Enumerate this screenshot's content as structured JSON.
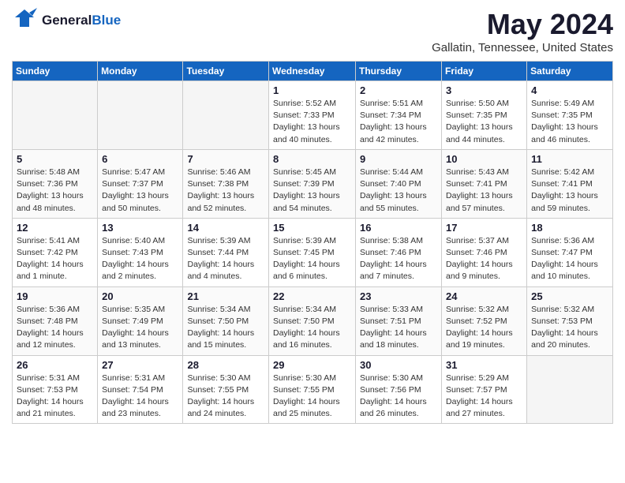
{
  "header": {
    "logo_general": "General",
    "logo_blue": "Blue",
    "month_title": "May 2024",
    "location": "Gallatin, Tennessee, United States"
  },
  "days_of_week": [
    "Sunday",
    "Monday",
    "Tuesday",
    "Wednesday",
    "Thursday",
    "Friday",
    "Saturday"
  ],
  "weeks": [
    [
      {
        "day": "",
        "info": ""
      },
      {
        "day": "",
        "info": ""
      },
      {
        "day": "",
        "info": ""
      },
      {
        "day": "1",
        "info": "Sunrise: 5:52 AM\nSunset: 7:33 PM\nDaylight: 13 hours\nand 40 minutes."
      },
      {
        "day": "2",
        "info": "Sunrise: 5:51 AM\nSunset: 7:34 PM\nDaylight: 13 hours\nand 42 minutes."
      },
      {
        "day": "3",
        "info": "Sunrise: 5:50 AM\nSunset: 7:35 PM\nDaylight: 13 hours\nand 44 minutes."
      },
      {
        "day": "4",
        "info": "Sunrise: 5:49 AM\nSunset: 7:35 PM\nDaylight: 13 hours\nand 46 minutes."
      }
    ],
    [
      {
        "day": "5",
        "info": "Sunrise: 5:48 AM\nSunset: 7:36 PM\nDaylight: 13 hours\nand 48 minutes."
      },
      {
        "day": "6",
        "info": "Sunrise: 5:47 AM\nSunset: 7:37 PM\nDaylight: 13 hours\nand 50 minutes."
      },
      {
        "day": "7",
        "info": "Sunrise: 5:46 AM\nSunset: 7:38 PM\nDaylight: 13 hours\nand 52 minutes."
      },
      {
        "day": "8",
        "info": "Sunrise: 5:45 AM\nSunset: 7:39 PM\nDaylight: 13 hours\nand 54 minutes."
      },
      {
        "day": "9",
        "info": "Sunrise: 5:44 AM\nSunset: 7:40 PM\nDaylight: 13 hours\nand 55 minutes."
      },
      {
        "day": "10",
        "info": "Sunrise: 5:43 AM\nSunset: 7:41 PM\nDaylight: 13 hours\nand 57 minutes."
      },
      {
        "day": "11",
        "info": "Sunrise: 5:42 AM\nSunset: 7:41 PM\nDaylight: 13 hours\nand 59 minutes."
      }
    ],
    [
      {
        "day": "12",
        "info": "Sunrise: 5:41 AM\nSunset: 7:42 PM\nDaylight: 14 hours\nand 1 minute."
      },
      {
        "day": "13",
        "info": "Sunrise: 5:40 AM\nSunset: 7:43 PM\nDaylight: 14 hours\nand 2 minutes."
      },
      {
        "day": "14",
        "info": "Sunrise: 5:39 AM\nSunset: 7:44 PM\nDaylight: 14 hours\nand 4 minutes."
      },
      {
        "day": "15",
        "info": "Sunrise: 5:39 AM\nSunset: 7:45 PM\nDaylight: 14 hours\nand 6 minutes."
      },
      {
        "day": "16",
        "info": "Sunrise: 5:38 AM\nSunset: 7:46 PM\nDaylight: 14 hours\nand 7 minutes."
      },
      {
        "day": "17",
        "info": "Sunrise: 5:37 AM\nSunset: 7:46 PM\nDaylight: 14 hours\nand 9 minutes."
      },
      {
        "day": "18",
        "info": "Sunrise: 5:36 AM\nSunset: 7:47 PM\nDaylight: 14 hours\nand 10 minutes."
      }
    ],
    [
      {
        "day": "19",
        "info": "Sunrise: 5:36 AM\nSunset: 7:48 PM\nDaylight: 14 hours\nand 12 minutes."
      },
      {
        "day": "20",
        "info": "Sunrise: 5:35 AM\nSunset: 7:49 PM\nDaylight: 14 hours\nand 13 minutes."
      },
      {
        "day": "21",
        "info": "Sunrise: 5:34 AM\nSunset: 7:50 PM\nDaylight: 14 hours\nand 15 minutes."
      },
      {
        "day": "22",
        "info": "Sunrise: 5:34 AM\nSunset: 7:50 PM\nDaylight: 14 hours\nand 16 minutes."
      },
      {
        "day": "23",
        "info": "Sunrise: 5:33 AM\nSunset: 7:51 PM\nDaylight: 14 hours\nand 18 minutes."
      },
      {
        "day": "24",
        "info": "Sunrise: 5:32 AM\nSunset: 7:52 PM\nDaylight: 14 hours\nand 19 minutes."
      },
      {
        "day": "25",
        "info": "Sunrise: 5:32 AM\nSunset: 7:53 PM\nDaylight: 14 hours\nand 20 minutes."
      }
    ],
    [
      {
        "day": "26",
        "info": "Sunrise: 5:31 AM\nSunset: 7:53 PM\nDaylight: 14 hours\nand 21 minutes."
      },
      {
        "day": "27",
        "info": "Sunrise: 5:31 AM\nSunset: 7:54 PM\nDaylight: 14 hours\nand 23 minutes."
      },
      {
        "day": "28",
        "info": "Sunrise: 5:30 AM\nSunset: 7:55 PM\nDaylight: 14 hours\nand 24 minutes."
      },
      {
        "day": "29",
        "info": "Sunrise: 5:30 AM\nSunset: 7:55 PM\nDaylight: 14 hours\nand 25 minutes."
      },
      {
        "day": "30",
        "info": "Sunrise: 5:30 AM\nSunset: 7:56 PM\nDaylight: 14 hours\nand 26 minutes."
      },
      {
        "day": "31",
        "info": "Sunrise: 5:29 AM\nSunset: 7:57 PM\nDaylight: 14 hours\nand 27 minutes."
      },
      {
        "day": "",
        "info": ""
      }
    ]
  ]
}
